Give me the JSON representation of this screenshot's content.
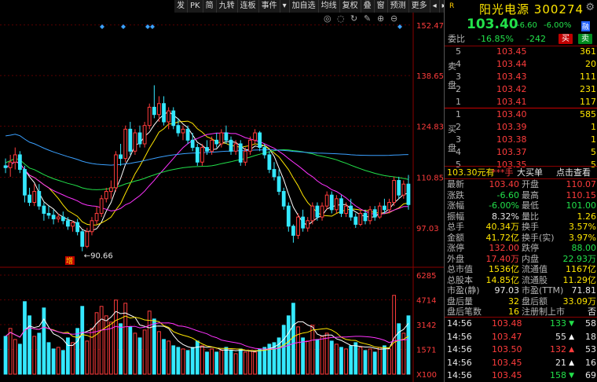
{
  "toolbar": {
    "items": [
      "发",
      "PK",
      "简",
      "九转",
      "连板",
      "事件",
      "▾",
      "加自选",
      "均线",
      "复权",
      "叠",
      "窗",
      "预测",
      "更多",
      "◂",
      "▸"
    ],
    "icons": [
      "eye-icon",
      "eye-slash-icon",
      "refresh-icon",
      "pen-icon",
      "plus-icon",
      "minus-icon"
    ]
  },
  "price_axis": {
    "labels": [
      "152.47",
      "138.65",
      "124.83",
      "110.85",
      "97.03"
    ],
    "low_marker": "←90.66",
    "event_badge": "增"
  },
  "volume_axis": {
    "labels": [
      "6285",
      "4714",
      "3142",
      "1571",
      "X100"
    ]
  },
  "chart_data": {
    "type": "candlestick",
    "price_range": [
      88,
      155
    ],
    "volume_range": [
      0,
      6285
    ],
    "volume_unit": "X100",
    "low_label": 90.66,
    "candles": [
      {
        "o": 114,
        "h": 116,
        "l": 112,
        "c": 113.5,
        "v": 2400
      },
      {
        "o": 113.5,
        "h": 117,
        "l": 111,
        "c": 115,
        "v": 2900
      },
      {
        "o": 115,
        "h": 119,
        "l": 113,
        "c": 117,
        "v": 2200
      },
      {
        "o": 117,
        "h": 118,
        "l": 112,
        "c": 113,
        "v": 1900
      },
      {
        "o": 113,
        "h": 114,
        "l": 104,
        "c": 106,
        "v": 4600
      },
      {
        "o": 106,
        "h": 108,
        "l": 103,
        "c": 104,
        "v": 3700
      },
      {
        "o": 104,
        "h": 109,
        "l": 103,
        "c": 107,
        "v": 2400
      },
      {
        "o": 107,
        "h": 109,
        "l": 102,
        "c": 103,
        "v": 2600
      },
      {
        "o": 103,
        "h": 104,
        "l": 99,
        "c": 101,
        "v": 4200
      },
      {
        "o": 101,
        "h": 103,
        "l": 99.5,
        "c": 100.5,
        "v": 2000
      },
      {
        "o": 100.5,
        "h": 102,
        "l": 98,
        "c": 99.5,
        "v": 1600
      },
      {
        "o": 99.5,
        "h": 101,
        "l": 98.5,
        "c": 100,
        "v": 1700
      },
      {
        "o": 100,
        "h": 101.5,
        "l": 98,
        "c": 99,
        "v": 1500
      },
      {
        "o": 99,
        "h": 100,
        "l": 96.5,
        "c": 97.5,
        "v": 2300
      },
      {
        "o": 97.5,
        "h": 99,
        "l": 96,
        "c": 98.5,
        "v": 2000
      },
      {
        "o": 98.5,
        "h": 99.5,
        "l": 95,
        "c": 96,
        "v": 2900
      },
      {
        "o": 96,
        "h": 96.5,
        "l": 90.66,
        "c": 92,
        "v": 4300
      },
      {
        "o": 92,
        "h": 97,
        "l": 91.5,
        "c": 96,
        "v": 2100
      },
      {
        "o": 96,
        "h": 100,
        "l": 95,
        "c": 99,
        "v": 2900
      },
      {
        "o": 99,
        "h": 103,
        "l": 98,
        "c": 101,
        "v": 3900
      },
      {
        "o": 101,
        "h": 106,
        "l": 100,
        "c": 105,
        "v": 4300
      },
      {
        "o": 105,
        "h": 108,
        "l": 104,
        "c": 107,
        "v": 3700
      },
      {
        "o": 107,
        "h": 110,
        "l": 105,
        "c": 108,
        "v": 3300
      },
      {
        "o": 108,
        "h": 118,
        "l": 107,
        "c": 117,
        "v": 4700
      },
      {
        "o": 117,
        "h": 120,
        "l": 114,
        "c": 116,
        "v": 3200
      },
      {
        "o": 116,
        "h": 125,
        "l": 115,
        "c": 124,
        "v": 4500
      },
      {
        "o": 124,
        "h": 126,
        "l": 117,
        "c": 118,
        "v": 3000
      },
      {
        "o": 118,
        "h": 124,
        "l": 117,
        "c": 123,
        "v": 2600
      },
      {
        "o": 123,
        "h": 125,
        "l": 119,
        "c": 120,
        "v": 2300
      },
      {
        "o": 120,
        "h": 126,
        "l": 119,
        "c": 125,
        "v": 2800
      },
      {
        "o": 125,
        "h": 131,
        "l": 124,
        "c": 130,
        "v": 4000
      },
      {
        "o": 130,
        "h": 136,
        "l": 127,
        "c": 128,
        "v": 3500
      },
      {
        "o": 128,
        "h": 133,
        "l": 126,
        "c": 131,
        "v": 2700
      },
      {
        "o": 131,
        "h": 133,
        "l": 125,
        "c": 126,
        "v": 2200
      },
      {
        "o": 126,
        "h": 130,
        "l": 124,
        "c": 129,
        "v": 2100
      },
      {
        "o": 129,
        "h": 130,
        "l": 124,
        "c": 125,
        "v": 1800
      },
      {
        "o": 125,
        "h": 127,
        "l": 122,
        "c": 123,
        "v": 1700
      },
      {
        "o": 123,
        "h": 125,
        "l": 121,
        "c": 124,
        "v": 1600
      },
      {
        "o": 124,
        "h": 125,
        "l": 120,
        "c": 121,
        "v": 1500
      },
      {
        "o": 121,
        "h": 123,
        "l": 118,
        "c": 119,
        "v": 1700
      },
      {
        "o": 119,
        "h": 120,
        "l": 114,
        "c": 115,
        "v": 2100
      },
      {
        "o": 115,
        "h": 120,
        "l": 114,
        "c": 119,
        "v": 1800
      },
      {
        "o": 119,
        "h": 121,
        "l": 117,
        "c": 118,
        "v": 1400
      },
      {
        "o": 118,
        "h": 122,
        "l": 117,
        "c": 121,
        "v": 1600
      },
      {
        "o": 121,
        "h": 123,
        "l": 119,
        "c": 120,
        "v": 1400
      },
      {
        "o": 120,
        "h": 124,
        "l": 119,
        "c": 123,
        "v": 1500
      },
      {
        "o": 123,
        "h": 125,
        "l": 120,
        "c": 121,
        "v": 1700
      },
      {
        "o": 121,
        "h": 122,
        "l": 117,
        "c": 118,
        "v": 1500
      },
      {
        "o": 118,
        "h": 121,
        "l": 117,
        "c": 120,
        "v": 1300
      },
      {
        "o": 120,
        "h": 121,
        "l": 114,
        "c": 115,
        "v": 1600
      },
      {
        "o": 115,
        "h": 119,
        "l": 114,
        "c": 118,
        "v": 1400
      },
      {
        "o": 118,
        "h": 122,
        "l": 117,
        "c": 121,
        "v": 1500
      },
      {
        "o": 121,
        "h": 124,
        "l": 120,
        "c": 123,
        "v": 1400
      },
      {
        "o": 123,
        "h": 123.5,
        "l": 118,
        "c": 119,
        "v": 1600
      },
      {
        "o": 119,
        "h": 120,
        "l": 116,
        "c": 117,
        "v": 1700
      },
      {
        "o": 117,
        "h": 118,
        "l": 112,
        "c": 113,
        "v": 1900
      },
      {
        "o": 113,
        "h": 115,
        "l": 110,
        "c": 111,
        "v": 2000
      },
      {
        "o": 111,
        "h": 113,
        "l": 106,
        "c": 107,
        "v": 2300
      },
      {
        "o": 107,
        "h": 108,
        "l": 102,
        "c": 103,
        "v": 3100
      },
      {
        "o": 103,
        "h": 104,
        "l": 96,
        "c": 97.5,
        "v": 3700
      },
      {
        "o": 97.5,
        "h": 98,
        "l": 93,
        "c": 95,
        "v": 4500
      },
      {
        "o": 95,
        "h": 101,
        "l": 94,
        "c": 100,
        "v": 3000
      },
      {
        "o": 100,
        "h": 102,
        "l": 96,
        "c": 97,
        "v": 2300
      },
      {
        "o": 97,
        "h": 100,
        "l": 96,
        "c": 99,
        "v": 2100
      },
      {
        "o": 99,
        "h": 104,
        "l": 98,
        "c": 103,
        "v": 3100
      },
      {
        "o": 103,
        "h": 104,
        "l": 99,
        "c": 100,
        "v": 2200
      },
      {
        "o": 100,
        "h": 104,
        "l": 99,
        "c": 103,
        "v": 2400
      },
      {
        "o": 103,
        "h": 107,
        "l": 102,
        "c": 106,
        "v": 2600
      },
      {
        "o": 106,
        "h": 107,
        "l": 101,
        "c": 102,
        "v": 2100
      },
      {
        "o": 102,
        "h": 106,
        "l": 101,
        "c": 105,
        "v": 1900
      },
      {
        "o": 105,
        "h": 106,
        "l": 100,
        "c": 101,
        "v": 1700
      },
      {
        "o": 101,
        "h": 104,
        "l": 100,
        "c": 103,
        "v": 1600
      },
      {
        "o": 103,
        "h": 105,
        "l": 99,
        "c": 100,
        "v": 1800
      },
      {
        "o": 100,
        "h": 101,
        "l": 97,
        "c": 98,
        "v": 2000
      },
      {
        "o": 98,
        "h": 102,
        "l": 97.5,
        "c": 101,
        "v": 1700
      },
      {
        "o": 101,
        "h": 102,
        "l": 98,
        "c": 99,
        "v": 1500
      },
      {
        "o": 99,
        "h": 103,
        "l": 98,
        "c": 102,
        "v": 1600
      },
      {
        "o": 102,
        "h": 103,
        "l": 99,
        "c": 100,
        "v": 1400
      },
      {
        "o": 100,
        "h": 104,
        "l": 99.5,
        "c": 103,
        "v": 1700
      },
      {
        "o": 103,
        "h": 105,
        "l": 101,
        "c": 102,
        "v": 1800
      },
      {
        "o": 102,
        "h": 105,
        "l": 101,
        "c": 104,
        "v": 1600
      },
      {
        "o": 104,
        "h": 111,
        "l": 103,
        "c": 110,
        "v": 5000
      },
      {
        "o": 110,
        "h": 111,
        "l": 105,
        "c": 106,
        "v": 3200
      },
      {
        "o": 106,
        "h": 110,
        "l": 105,
        "c": 109,
        "v": 2600
      },
      {
        "o": 109,
        "h": 111.5,
        "l": 102,
        "c": 103.4,
        "v": 3700
      }
    ],
    "ma": [
      {
        "name": "MA5",
        "color": "#ffffff"
      },
      {
        "name": "MA10",
        "color": "#ffe600"
      },
      {
        "name": "MA20",
        "color": "#ff33ff"
      },
      {
        "name": "MA60",
        "color": "#22e04a"
      },
      {
        "name": "MA120",
        "color": "#3aa0ff"
      }
    ]
  },
  "quote": {
    "logo": "R",
    "name": "阳光电源",
    "code": "300274",
    "price": "103.40",
    "change": "-6.60",
    "change_pct": "-6.00%",
    "tag": "融",
    "weibi_label": "委比",
    "weibi_pct": "-16.85%",
    "weicha": "-242",
    "buy_btn": "买",
    "sell_btn": "卖",
    "sell_side_label": [
      "卖",
      "盘"
    ],
    "buy_side_label": [
      "买",
      "盘"
    ],
    "asks": [
      {
        "lvl": "5",
        "price": "103.45",
        "vol": "361"
      },
      {
        "lvl": "4",
        "price": "103.44",
        "vol": "20"
      },
      {
        "lvl": "3",
        "price": "103.43",
        "vol": "111"
      },
      {
        "lvl": "2",
        "price": "103.42",
        "vol": "231"
      },
      {
        "lvl": "1",
        "price": "103.41",
        "vol": "117"
      }
    ],
    "bids": [
      {
        "lvl": "1",
        "price": "103.40",
        "vol": "585"
      },
      {
        "lvl": "2",
        "price": "103.39",
        "vol": "1"
      },
      {
        "lvl": "3",
        "price": "103.38",
        "vol": "1"
      },
      {
        "lvl": "4",
        "price": "103.37",
        "vol": "5"
      },
      {
        "lvl": "5",
        "price": "103.35",
        "vol": "5"
      }
    ],
    "bigorder": {
      "price": "103.30元有",
      "qty": "***手",
      "label": "大买单",
      "link": "点击查看"
    },
    "stats": [
      {
        "l1": "最新",
        "v1": "103.40",
        "c1": "red",
        "l2": "开盘",
        "v2": "110.07",
        "c2": "red"
      },
      {
        "l1": "涨跌",
        "v1": "-6.60",
        "c1": "green",
        "l2": "最高",
        "v2": "110.15",
        "c2": "red"
      },
      {
        "l1": "涨幅",
        "v1": "-6.00%",
        "c1": "green",
        "l2": "最低",
        "v2": "101.00",
        "c2": "green"
      },
      {
        "l1": "振幅",
        "v1": "8.32%",
        "c1": "white",
        "l2": "量比",
        "v2": "1.26",
        "c2": "yellow"
      },
      {
        "l1": "总手",
        "v1": "40.34万",
        "c1": "yellow",
        "l2": "换手",
        "v2": "3.57%",
        "c2": "yellow"
      },
      {
        "l1": "金额",
        "v1": "41.72亿",
        "c1": "yellow",
        "l2": "换手(实)",
        "v2": "3.97%",
        "c2": "yellow"
      },
      {
        "l1": "涨停",
        "v1": "132.00",
        "c1": "red",
        "l2": "跌停",
        "v2": "88.00",
        "c2": "green"
      },
      {
        "l1": "外盘",
        "v1": "17.40万",
        "c1": "red",
        "l2": "内盘",
        "v2": "22.93万",
        "c2": "green"
      },
      {
        "l1": "总市值",
        "v1": "1536亿",
        "c1": "yellow",
        "l2": "流通值",
        "v2": "1167亿",
        "c2": "yellow"
      },
      {
        "l1": "总股本",
        "v1": "14.85亿",
        "c1": "yellow",
        "l2": "流通股",
        "v2": "11.29亿",
        "c2": "yellow"
      },
      {
        "l1": "市盈(静)",
        "v1": "97.03",
        "c1": "white",
        "l2": "市盈(TTM)",
        "v2": "71.81",
        "c2": "white"
      },
      {
        "l1": "盘后量",
        "v1": "32",
        "c1": "yellow",
        "l2": "盘后额",
        "v2": "33.09万",
        "c2": "yellow"
      },
      {
        "l1": "盘后笔数",
        "v1": "16",
        "c1": "yellow",
        "l2": "注册制上市",
        "v2": "否",
        "c2": "white"
      }
    ],
    "ticks": [
      {
        "time": "14:56",
        "price": "103.48",
        "pc": "red",
        "vol": "133",
        "dir": "down",
        "n": "58"
      },
      {
        "time": "14:56",
        "price": "103.47",
        "pc": "red",
        "vol": "55",
        "dir": "up",
        "n": "18"
      },
      {
        "time": "14:56",
        "price": "103.50",
        "pc": "red",
        "vol": "132",
        "dir": "up",
        "n": "53"
      },
      {
        "time": "14:56",
        "price": "103.45",
        "pc": "red",
        "vol": "21",
        "dir": "up",
        "n": "16"
      },
      {
        "time": "14:56",
        "price": "103.45",
        "pc": "red",
        "vol": "158",
        "dir": "down",
        "n": "69"
      }
    ]
  }
}
